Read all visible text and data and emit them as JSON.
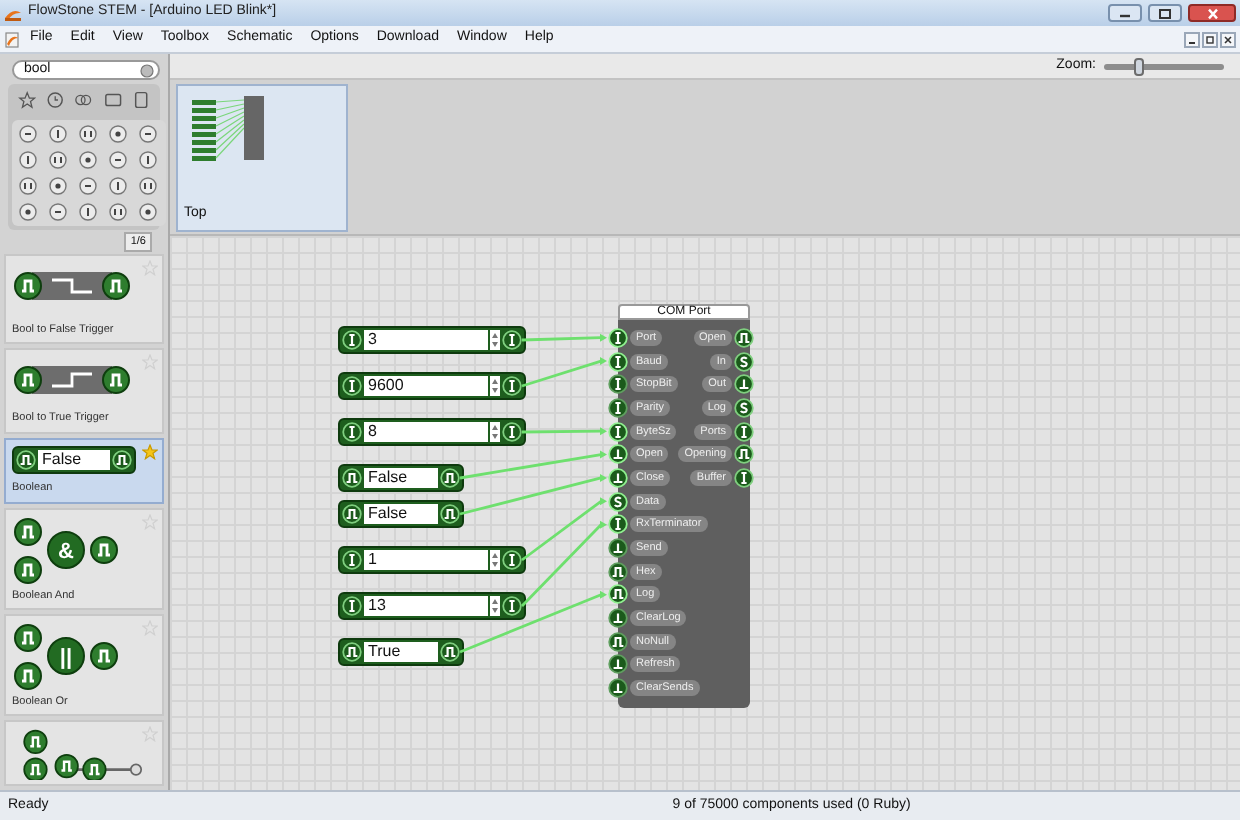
{
  "window": {
    "title": "FlowStone STEM - [Arduino LED Blink*]"
  },
  "menu": [
    "File",
    "Edit",
    "View",
    "Toolbox",
    "Schematic",
    "Options",
    "Download",
    "Window",
    "Help"
  ],
  "toolbox": {
    "search": {
      "value": "bool"
    },
    "page": "1/6",
    "items": [
      {
        "label": "Bool to False Trigger",
        "kind": "stepdown",
        "selected": false,
        "favorite": false
      },
      {
        "label": "Bool to True Trigger",
        "kind": "stepup",
        "selected": false,
        "favorite": false
      },
      {
        "label": "Boolean",
        "kind": "value",
        "value": "False",
        "selected": true,
        "favorite": true
      },
      {
        "label": "Boolean And",
        "kind": "gate",
        "symbol": "&",
        "selected": false,
        "favorite": false
      },
      {
        "label": "Boolean Or",
        "kind": "gate",
        "symbol": "||",
        "selected": false,
        "favorite": false
      },
      {
        "kind": "partial",
        "selected": false,
        "favorite": false
      }
    ]
  },
  "navigator": {
    "thumbnail_label": "Top"
  },
  "zoom": {
    "label": "Zoom:",
    "level": 0.3
  },
  "schematic": {
    "inputs": [
      {
        "kind": "int",
        "value": "3"
      },
      {
        "kind": "int",
        "value": "9600"
      },
      {
        "kind": "int",
        "value": "8"
      },
      {
        "kind": "bool",
        "value": "False"
      },
      {
        "kind": "bool",
        "value": "False"
      },
      {
        "kind": "int",
        "value": "1"
      },
      {
        "kind": "int",
        "value": "13"
      },
      {
        "kind": "bool",
        "value": "True"
      }
    ],
    "com_port": {
      "title": "COM Port",
      "inputs": [
        {
          "label": "Port",
          "kind": "int",
          "connected": true
        },
        {
          "label": "Baud",
          "kind": "int",
          "connected": true
        },
        {
          "label": "StopBit",
          "kind": "int",
          "connected": false
        },
        {
          "label": "Parity",
          "kind": "int",
          "connected": false
        },
        {
          "label": "ByteSz",
          "kind": "int",
          "connected": true
        },
        {
          "label": "Open",
          "kind": "trigger",
          "connected": true
        },
        {
          "label": "Close",
          "kind": "trigger",
          "connected": true
        },
        {
          "label": "Data",
          "kind": "string",
          "connected": true
        },
        {
          "label": "RxTerminator",
          "kind": "int",
          "connected": true
        },
        {
          "label": "Send",
          "kind": "trigger",
          "connected": false
        },
        {
          "label": "Hex",
          "kind": "bool",
          "connected": false
        },
        {
          "label": "Log",
          "kind": "bool",
          "connected": true
        },
        {
          "label": "ClearLog",
          "kind": "trigger",
          "connected": false
        },
        {
          "label": "NoNull",
          "kind": "bool",
          "connected": false
        },
        {
          "label": "Refresh",
          "kind": "trigger",
          "connected": false
        },
        {
          "label": "ClearSends",
          "kind": "trigger",
          "connected": false
        }
      ],
      "outputs": [
        {
          "label": "Open",
          "kind": "bool"
        },
        {
          "label": "In",
          "kind": "string"
        },
        {
          "label": "Out",
          "kind": "trigger"
        },
        {
          "label": "Log",
          "kind": "string"
        },
        {
          "label": "Ports",
          "kind": "int"
        },
        {
          "label": "Opening",
          "kind": "bool"
        },
        {
          "label": "Buffer",
          "kind": "int"
        }
      ]
    }
  },
  "status_bar": {
    "left": "Ready",
    "right": "9 of 75000 components used (0 Ruby)"
  }
}
